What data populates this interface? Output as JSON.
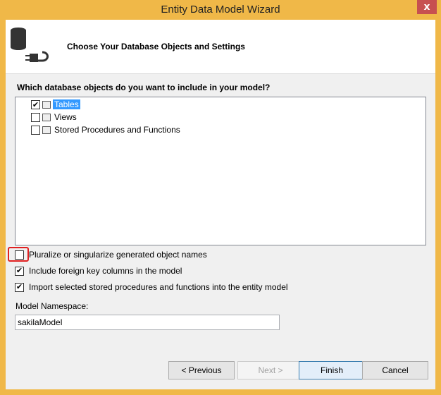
{
  "window": {
    "title": "Entity Data Model Wizard",
    "close_glyph": "x"
  },
  "header": {
    "title": "Choose Your Database Objects and Settings"
  },
  "question": "Which database objects do you want to include in your model?",
  "tree": {
    "items": [
      {
        "label": "Tables",
        "checked": true,
        "selected": true
      },
      {
        "label": "Views",
        "checked": false,
        "selected": false
      },
      {
        "label": "Stored Procedures and Functions",
        "checked": false,
        "selected": false
      }
    ]
  },
  "options": [
    {
      "label": "Pluralize or singularize generated object names",
      "checked": false
    },
    {
      "label": "Include foreign key columns in the model",
      "checked": true
    },
    {
      "label": "Import selected stored procedures and functions into the entity model",
      "checked": true
    }
  ],
  "namespace": {
    "label": "Model Namespace:",
    "value": "sakilaModel"
  },
  "buttons": {
    "previous": "< Previous",
    "next": "Next >",
    "finish": "Finish",
    "cancel": "Cancel"
  },
  "icons": {
    "database": "database-plug-icon",
    "check": "✔"
  }
}
